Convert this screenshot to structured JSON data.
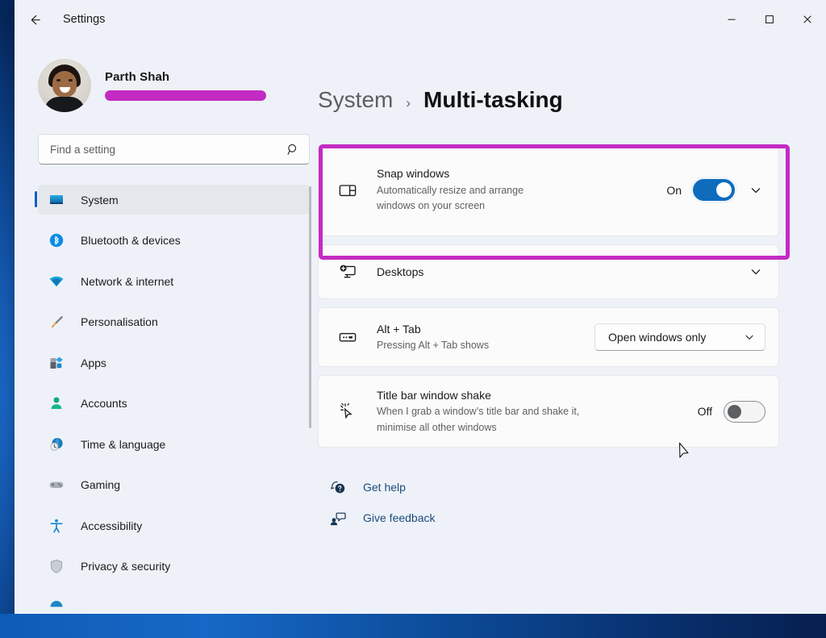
{
  "window": {
    "app_title": "Settings",
    "back_icon": "back-arrow-icon",
    "controls": {
      "minimize": "minimize-icon",
      "maximize": "maximize-icon",
      "close": "close-icon"
    }
  },
  "account": {
    "name": "Parth Shah",
    "email_redacted": true,
    "redaction_color": "#c42bc4",
    "avatar_alt": "user-avatar"
  },
  "search": {
    "placeholder": "Find a setting",
    "value": "",
    "icon": "search-icon"
  },
  "sidebar": {
    "items": [
      {
        "label": "System",
        "icon": "monitor-icon",
        "selected": true
      },
      {
        "label": "Bluetooth & devices",
        "icon": "bluetooth-icon",
        "selected": false
      },
      {
        "label": "Network & internet",
        "icon": "wifi-icon",
        "selected": false
      },
      {
        "label": "Personalisation",
        "icon": "paintbrush-icon",
        "selected": false
      },
      {
        "label": "Apps",
        "icon": "apps-icon",
        "selected": false
      },
      {
        "label": "Accounts",
        "icon": "person-icon",
        "selected": false
      },
      {
        "label": "Time & language",
        "icon": "clock-globe-icon",
        "selected": false
      },
      {
        "label": "Gaming",
        "icon": "gamepad-icon",
        "selected": false
      },
      {
        "label": "Accessibility",
        "icon": "accessibility-icon",
        "selected": false
      },
      {
        "label": "Privacy & security",
        "icon": "shield-icon",
        "selected": false
      },
      {
        "label": "",
        "icon": "windows-update-icon",
        "selected": false
      }
    ]
  },
  "header": {
    "breadcrumb_parent": "System",
    "breadcrumb_separator": "›",
    "breadcrumb_current": "Multi-tasking"
  },
  "settings_cards": [
    {
      "id": "snap-windows",
      "title": "Snap windows",
      "description": "Automatically resize and arrange windows on your screen",
      "icon": "snap-layout-icon",
      "state_label": "On",
      "toggle": "on",
      "has_chevron": true,
      "highlighted": true
    },
    {
      "id": "desktops",
      "title": "Desktops",
      "description": "",
      "icon": "desktop-add-icon",
      "state_label": "",
      "toggle": "none",
      "has_chevron": true,
      "highlighted": false
    },
    {
      "id": "alt-tab",
      "title": "Alt + Tab",
      "description": "Pressing Alt + Tab shows",
      "icon": "keyboard-icon",
      "dropdown_value": "Open windows only",
      "toggle": "none",
      "has_chevron": false,
      "highlighted": false
    },
    {
      "id": "title-bar-window-shake",
      "title": "Title bar window shake",
      "description": "When I grab a window’s title bar and shake it, minimise all other windows",
      "icon": "cursor-shake-icon",
      "state_label": "Off",
      "toggle": "off",
      "has_chevron": false,
      "highlighted": false
    }
  ],
  "footer_links": [
    {
      "label": "Get help",
      "icon": "help-icon"
    },
    {
      "label": "Give feedback",
      "icon": "feedback-icon"
    }
  ],
  "colors": {
    "accent_blue": "#0f6cbd",
    "highlight_magenta": "#c42bc4",
    "link_blue": "#1d4b7d",
    "window_bg": "#eef2f8",
    "card_bg": "#fbfbfb"
  }
}
